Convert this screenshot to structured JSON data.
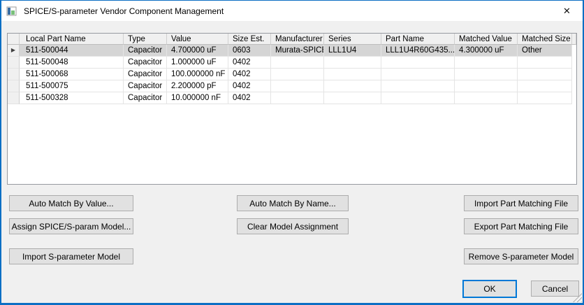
{
  "window": {
    "title": "SPICE/S-parameter Vendor Component Management",
    "close_glyph": "✕"
  },
  "table": {
    "row_indicator": "▶",
    "columns": [
      "Local Part Name",
      "Type",
      "Value",
      "Size Est.",
      "Manufacturer",
      "Series",
      "Part Name",
      "Matched Value",
      "Matched Size"
    ],
    "rows": [
      {
        "cells": [
          "511-500044",
          "Capacitor",
          "4.700000 uF",
          "0603",
          "Murata-SPICE",
          "LLL1U4",
          "LLL1U4R60G435...",
          "4.300000 uF",
          "Other"
        ]
      },
      {
        "cells": [
          "511-500048",
          "Capacitor",
          "1.000000 uF",
          "0402",
          "",
          "",
          "",
          "",
          ""
        ]
      },
      {
        "cells": [
          "511-500068",
          "Capacitor",
          "100.000000 nF",
          "0402",
          "",
          "",
          "",
          "",
          ""
        ]
      },
      {
        "cells": [
          "511-500075",
          "Capacitor",
          "2.200000 pF",
          "0402",
          "",
          "",
          "",
          "",
          ""
        ]
      },
      {
        "cells": [
          "511-500328",
          "Capacitor",
          "10.000000 nF",
          "0402",
          "",
          "",
          "",
          "",
          ""
        ]
      }
    ]
  },
  "buttons": {
    "auto_match_value": "Auto Match By Value...",
    "assign_model": "Assign SPICE/S-param Model...",
    "import_sparam": "Import S-parameter Model",
    "auto_match_name": "Auto Match By Name...",
    "clear_assignment": "Clear Model Assignment",
    "import_part_matching": "Import Part Matching File",
    "export_part_matching": "Export Part Matching File",
    "remove_sparam": "Remove S-parameter Model",
    "ok": "OK",
    "cancel": "Cancel"
  },
  "colors": {
    "accent": "#0078d7",
    "selected_row": "#d5d5d5",
    "titlebar_bg": "#ffffff",
    "dialog_bg": "#f0f0f0"
  }
}
